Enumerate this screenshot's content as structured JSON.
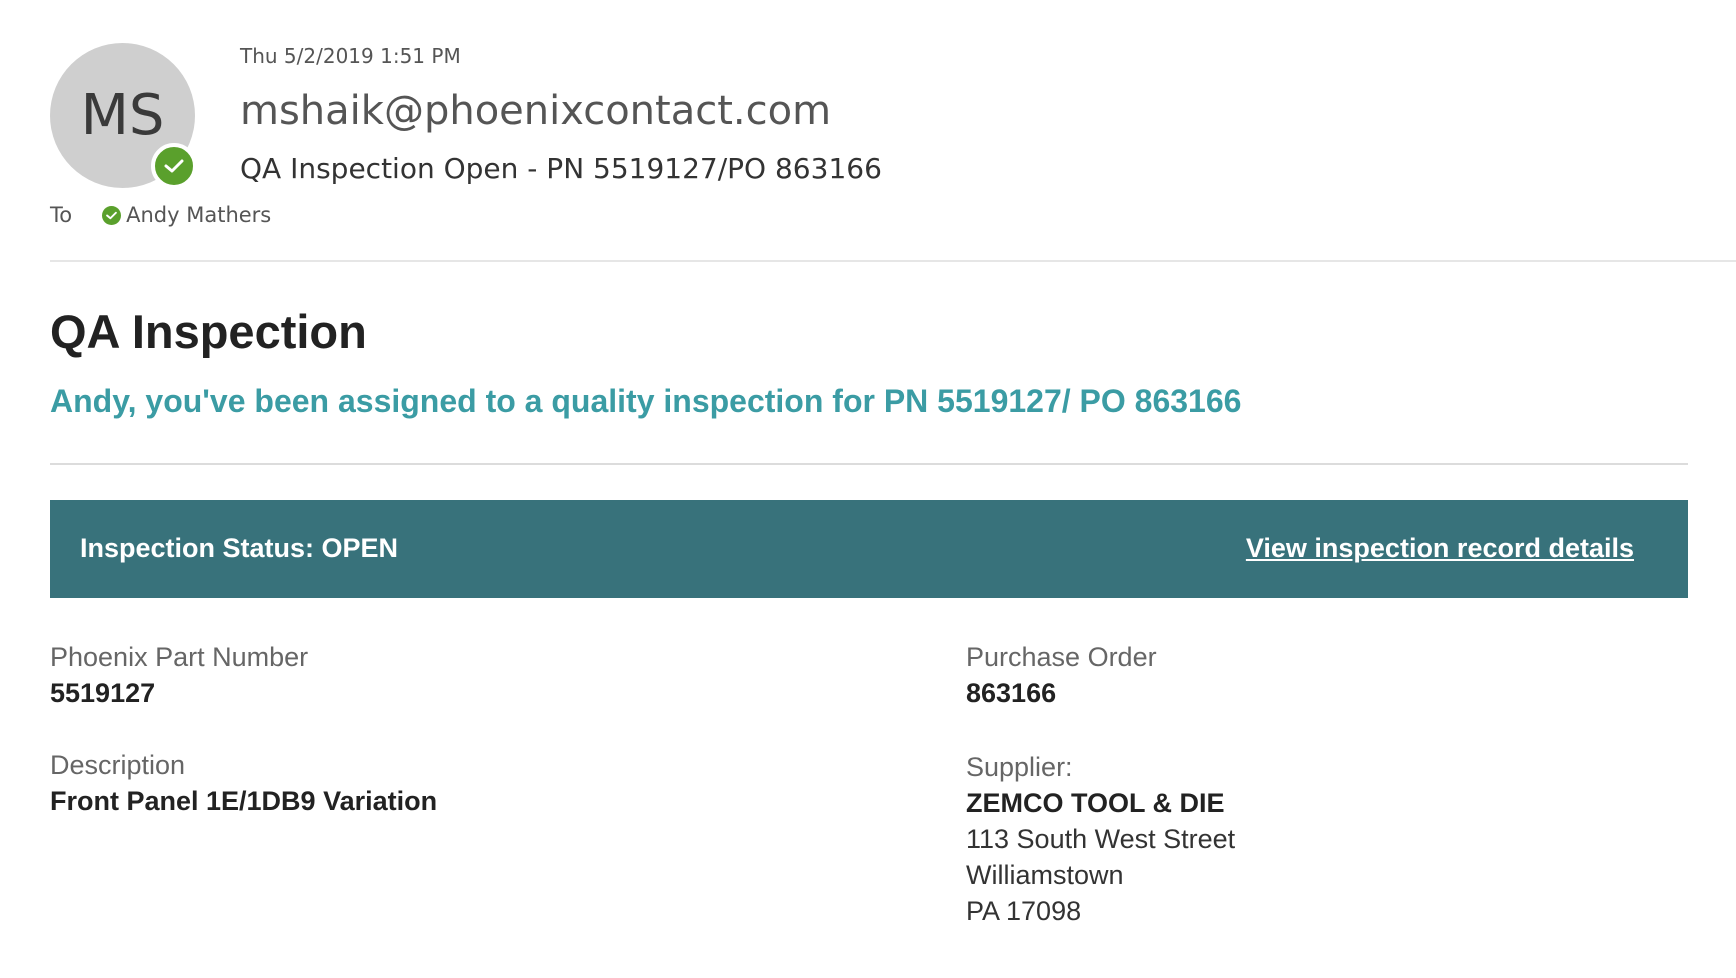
{
  "header": {
    "avatar_initials": "MS",
    "date": "Thu 5/2/2019 1:51 PM",
    "sender": "mshaik@phoenixcontact.com",
    "subject": "QA Inspection Open - PN 5519127/PO 863166",
    "to_label": "To",
    "recipient": "Andy Mathers",
    "presence_color": "#5aa02c"
  },
  "body": {
    "title": "QA Inspection",
    "intro": "Andy, you've been assigned to a quality inspection for PN 5519127/ PO 863166",
    "intro_color": "#3b9ca4",
    "status_bar_color": "#38727b",
    "status_text": "Inspection Status: OPEN",
    "status_link": "View inspection record details",
    "fields": {
      "part_number_label": "Phoenix Part Number",
      "part_number": "5519127",
      "purchase_order_label": "Purchase Order",
      "purchase_order": "863166",
      "description_label": "Description",
      "description": "Front Panel 1E/1DB9 Variation",
      "supplier_label": "Supplier:",
      "supplier_name": "ZEMCO TOOL & DIE",
      "supplier_street": "113 South West Street",
      "supplier_city": "Williamstown",
      "supplier_state_zip": "PA 17098"
    }
  }
}
